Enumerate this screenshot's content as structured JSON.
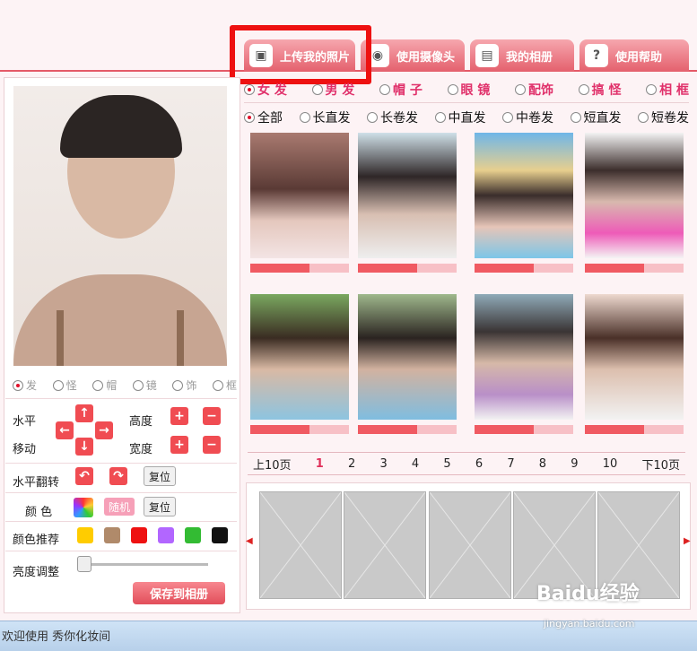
{
  "tabs": [
    {
      "label": "上传我的照片",
      "icon": "upload-icon"
    },
    {
      "label": "使用摄像头",
      "icon": "camera-icon"
    },
    {
      "label": "我的相册",
      "icon": "album-icon"
    },
    {
      "label": "使用帮助",
      "icon": "help-icon"
    }
  ],
  "categories": [
    {
      "label": "女 发",
      "selected": true
    },
    {
      "label": "男 发",
      "selected": false
    },
    {
      "label": "帽 子",
      "selected": false
    },
    {
      "label": "眼 镜",
      "selected": false
    },
    {
      "label": "配饰",
      "selected": false
    },
    {
      "label": "搞 怪",
      "selected": false
    },
    {
      "label": "相 框",
      "selected": false
    }
  ],
  "subcategories": [
    {
      "label": "全部",
      "selected": true
    },
    {
      "label": "长直发",
      "selected": false
    },
    {
      "label": "长卷发",
      "selected": false
    },
    {
      "label": "中直发",
      "selected": false
    },
    {
      "label": "中卷发",
      "selected": false
    },
    {
      "label": "短直发",
      "selected": false
    },
    {
      "label": "短卷发",
      "selected": false
    }
  ],
  "layer_radios": [
    "发",
    "怪",
    "帽",
    "镜",
    "饰",
    "框"
  ],
  "controls": {
    "horizontal": "水平",
    "move": "移动",
    "height": "高度",
    "width": "宽度",
    "flip": "水平翻转",
    "reset": "复位",
    "color": "颜 色",
    "random": "随机",
    "color_reco": "颜色推荐",
    "brightness": "亮度调整",
    "save": "保存到相册"
  },
  "swatch_colors": [
    "#ffcc00",
    "#b08a6a",
    "#ee1111",
    "#b266ff",
    "#33bb33",
    "#111111"
  ],
  "pagination": {
    "prev": "上10页",
    "pages": [
      "1",
      "2",
      "3",
      "4",
      "5",
      "6",
      "7",
      "8",
      "9",
      "10"
    ],
    "next": "下10页",
    "current": "1"
  },
  "status": "欢迎使用  秀你化妆间",
  "watermark": "Baidu经验",
  "watermark_url": "jingyan.baidu.com"
}
